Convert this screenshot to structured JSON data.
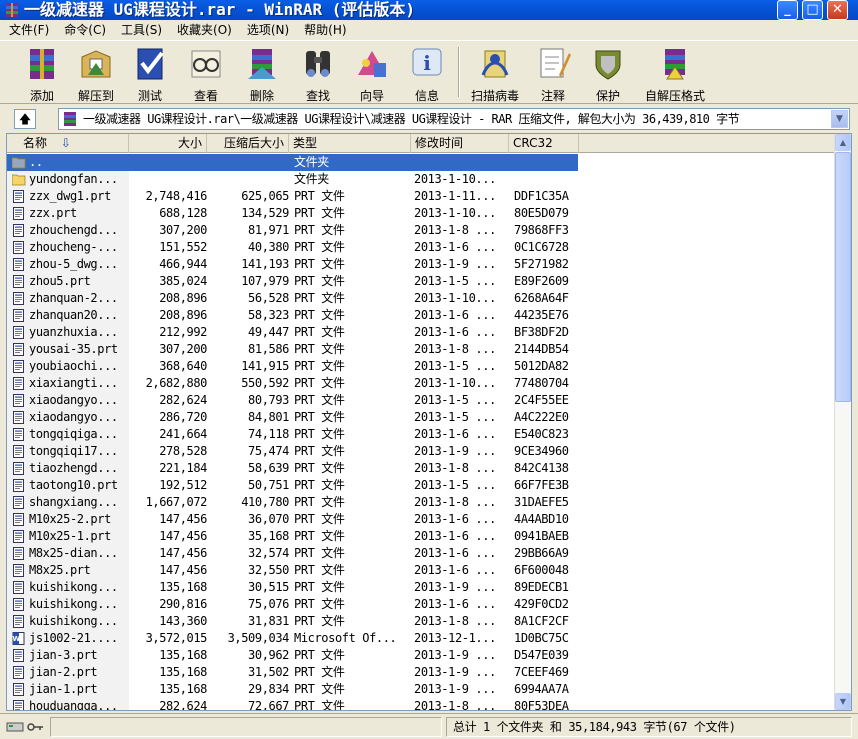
{
  "window": {
    "title": "一级减速器 UG课程设计.rar - WinRAR (评估版本)"
  },
  "menu": [
    "文件(F)",
    "命令(C)",
    "工具(S)",
    "收藏夹(O)",
    "选项(N)",
    "帮助(H)"
  ],
  "toolbar": [
    {
      "label": "添加",
      "icon": "add-archive-icon"
    },
    {
      "label": "解压到",
      "icon": "extract-to-icon"
    },
    {
      "label": "测试",
      "icon": "test-icon"
    },
    {
      "label": "查看",
      "icon": "view-icon"
    },
    {
      "label": "删除",
      "icon": "delete-icon"
    },
    {
      "label": "查找",
      "icon": "find-icon"
    },
    {
      "label": "向导",
      "icon": "wizard-icon"
    },
    {
      "label": "信息",
      "icon": "info-icon"
    },
    {
      "label": "扫描病毒",
      "icon": "virus-scan-icon"
    },
    {
      "label": "注释",
      "icon": "comment-icon"
    },
    {
      "label": "保护",
      "icon": "protect-icon"
    },
    {
      "label": "自解压格式",
      "icon": "sfx-icon"
    }
  ],
  "address": {
    "path": "一级减速器 UG课程设计.rar\\一级减速器 UG课程设计\\减速器 UG课程设计 - RAR 压缩文件, 解包大小为 36,439,810 字节"
  },
  "columns": [
    "名称",
    "大小",
    "压缩后大小",
    "类型",
    "修改时间",
    "CRC32"
  ],
  "files": [
    {
      "name": "..",
      "size": "",
      "packed": "",
      "type": "文件夹",
      "modified": "",
      "crc": "",
      "kind": "folder",
      "selected": true
    },
    {
      "name": "yundongfan...",
      "size": "",
      "packed": "",
      "type": "文件夹",
      "modified": "2013-1-10...",
      "crc": "",
      "kind": "folder"
    },
    {
      "name": "zzx_dwg1.prt",
      "size": "2,748,416",
      "packed": "625,065",
      "type": "PRT 文件",
      "modified": "2013-1-11...",
      "crc": "DDF1C35A",
      "kind": "file"
    },
    {
      "name": "zzx.prt",
      "size": "688,128",
      "packed": "134,529",
      "type": "PRT 文件",
      "modified": "2013-1-10...",
      "crc": "80E5D079",
      "kind": "file"
    },
    {
      "name": "zhouchengd...",
      "size": "307,200",
      "packed": "81,971",
      "type": "PRT 文件",
      "modified": "2013-1-8 ...",
      "crc": "79868FF3",
      "kind": "file"
    },
    {
      "name": "zhoucheng-...",
      "size": "151,552",
      "packed": "40,380",
      "type": "PRT 文件",
      "modified": "2013-1-6 ...",
      "crc": "0C1C6728",
      "kind": "file"
    },
    {
      "name": "zhou-5_dwg...",
      "size": "466,944",
      "packed": "141,193",
      "type": "PRT 文件",
      "modified": "2013-1-9 ...",
      "crc": "5F271982",
      "kind": "file"
    },
    {
      "name": "zhou5.prt",
      "size": "385,024",
      "packed": "107,979",
      "type": "PRT 文件",
      "modified": "2013-1-5 ...",
      "crc": "E89F2609",
      "kind": "file"
    },
    {
      "name": "zhanquan-2...",
      "size": "208,896",
      "packed": "56,528",
      "type": "PRT 文件",
      "modified": "2013-1-10...",
      "crc": "6268A64F",
      "kind": "file"
    },
    {
      "name": "zhanquan20...",
      "size": "208,896",
      "packed": "58,323",
      "type": "PRT 文件",
      "modified": "2013-1-6 ...",
      "crc": "44235E76",
      "kind": "file"
    },
    {
      "name": "yuanzhuxia...",
      "size": "212,992",
      "packed": "49,447",
      "type": "PRT 文件",
      "modified": "2013-1-6 ...",
      "crc": "BF38DF2D",
      "kind": "file"
    },
    {
      "name": "yousai-35.prt",
      "size": "307,200",
      "packed": "81,586",
      "type": "PRT 文件",
      "modified": "2013-1-8 ...",
      "crc": "2144DB54",
      "kind": "file"
    },
    {
      "name": "youbiaochi...",
      "size": "368,640",
      "packed": "141,915",
      "type": "PRT 文件",
      "modified": "2013-1-5 ...",
      "crc": "5012DA82",
      "kind": "file"
    },
    {
      "name": "xiaxiangti...",
      "size": "2,682,880",
      "packed": "550,592",
      "type": "PRT 文件",
      "modified": "2013-1-10...",
      "crc": "77480704",
      "kind": "file"
    },
    {
      "name": "xiaodangyo...",
      "size": "282,624",
      "packed": "80,793",
      "type": "PRT 文件",
      "modified": "2013-1-5 ...",
      "crc": "2C4F55EE",
      "kind": "file"
    },
    {
      "name": "xiaodangyo...",
      "size": "286,720",
      "packed": "84,801",
      "type": "PRT 文件",
      "modified": "2013-1-5 ...",
      "crc": "A4C222E0",
      "kind": "file"
    },
    {
      "name": "tongqiqiga...",
      "size": "241,664",
      "packed": "74,118",
      "type": "PRT 文件",
      "modified": "2013-1-6 ...",
      "crc": "E540C823",
      "kind": "file"
    },
    {
      "name": "tongqiqi17...",
      "size": "278,528",
      "packed": "75,474",
      "type": "PRT 文件",
      "modified": "2013-1-9 ...",
      "crc": "9CE34960",
      "kind": "file"
    },
    {
      "name": "tiaozhengd...",
      "size": "221,184",
      "packed": "58,639",
      "type": "PRT 文件",
      "modified": "2013-1-8 ...",
      "crc": "842C4138",
      "kind": "file"
    },
    {
      "name": "taotong10.prt",
      "size": "192,512",
      "packed": "50,751",
      "type": "PRT 文件",
      "modified": "2013-1-5 ...",
      "crc": "66F7FE3B",
      "kind": "file"
    },
    {
      "name": "shangxiang...",
      "size": "1,667,072",
      "packed": "410,780",
      "type": "PRT 文件",
      "modified": "2013-1-8 ...",
      "crc": "31DAEFE5",
      "kind": "file"
    },
    {
      "name": "M10x25-2.prt",
      "size": "147,456",
      "packed": "36,070",
      "type": "PRT 文件",
      "modified": "2013-1-6 ...",
      "crc": "4A4ABD10",
      "kind": "file"
    },
    {
      "name": "M10x25-1.prt",
      "size": "147,456",
      "packed": "35,168",
      "type": "PRT 文件",
      "modified": "2013-1-6 ...",
      "crc": "0941BAEB",
      "kind": "file"
    },
    {
      "name": "M8x25-dian...",
      "size": "147,456",
      "packed": "32,574",
      "type": "PRT 文件",
      "modified": "2013-1-6 ...",
      "crc": "29BB66A9",
      "kind": "file"
    },
    {
      "name": "M8x25.prt",
      "size": "147,456",
      "packed": "32,550",
      "type": "PRT 文件",
      "modified": "2013-1-6 ...",
      "crc": "6F600048",
      "kind": "file"
    },
    {
      "name": "kuishikong...",
      "size": "135,168",
      "packed": "30,515",
      "type": "PRT 文件",
      "modified": "2013-1-9 ...",
      "crc": "89EDECB1",
      "kind": "file"
    },
    {
      "name": "kuishikong...",
      "size": "290,816",
      "packed": "75,076",
      "type": "PRT 文件",
      "modified": "2013-1-6 ...",
      "crc": "429F0CD2",
      "kind": "file"
    },
    {
      "name": "kuishikong...",
      "size": "143,360",
      "packed": "31,831",
      "type": "PRT 文件",
      "modified": "2013-1-8 ...",
      "crc": "8A1CF2CF",
      "kind": "file"
    },
    {
      "name": "js1002-21....",
      "size": "3,572,015",
      "packed": "3,509,034",
      "type": "Microsoft Of...",
      "modified": "2013-12-1...",
      "crc": "1D0BC75C",
      "kind": "doc"
    },
    {
      "name": "jian-3.prt",
      "size": "135,168",
      "packed": "30,962",
      "type": "PRT 文件",
      "modified": "2013-1-9 ...",
      "crc": "D547E039",
      "kind": "file"
    },
    {
      "name": "jian-2.prt",
      "size": "135,168",
      "packed": "31,502",
      "type": "PRT 文件",
      "modified": "2013-1-9 ...",
      "crc": "7CEEF469",
      "kind": "file"
    },
    {
      "name": "jian-1.prt",
      "size": "135,168",
      "packed": "29,834",
      "type": "PRT 文件",
      "modified": "2013-1-9 ...",
      "crc": "6994AA7A",
      "kind": "file"
    },
    {
      "name": "houduangga...",
      "size": "282,624",
      "packed": "72,667",
      "type": "PRT 文件",
      "modified": "2013-1-8 ...",
      "crc": "80F53DEA",
      "kind": "file"
    }
  ],
  "status": {
    "summary": "总计 1 个文件夹 和 35,184,943 字节(67 个文件)"
  },
  "colors": {
    "titlebar": "#0653d6",
    "selection": "#316ac5",
    "chrome": "#ece9d8"
  }
}
